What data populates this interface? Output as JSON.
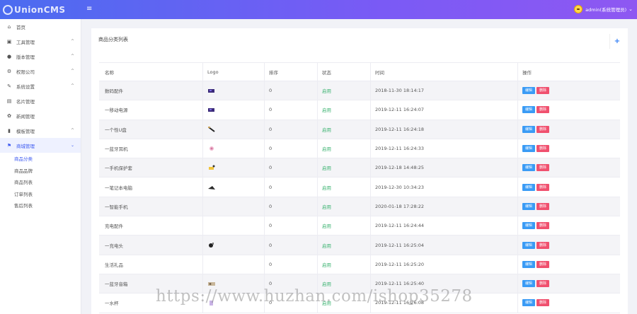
{
  "header": {
    "logo_text": "UnionCMS",
    "user_label": "admin(系统管理员)"
  },
  "sidebar": {
    "items": [
      {
        "label": "首页",
        "icon": "home-icon",
        "has_arrow": false,
        "arrow": ""
      },
      {
        "label": "工具管理",
        "icon": "tools-icon",
        "has_arrow": true,
        "arrow": "^"
      },
      {
        "label": "版本管理",
        "icon": "user-icon",
        "has_arrow": true,
        "arrow": "^"
      },
      {
        "label": "权限公司",
        "icon": "settings-icon",
        "has_arrow": true,
        "arrow": "^"
      },
      {
        "label": "系统设置",
        "icon": "wrench-icon",
        "has_arrow": true,
        "arrow": "^"
      },
      {
        "label": "名片管理",
        "icon": "card-icon",
        "has_arrow": false,
        "arrow": ""
      },
      {
        "label": "新闻管理",
        "icon": "gear-icon",
        "has_arrow": false,
        "arrow": ""
      },
      {
        "label": "模板管理",
        "icon": "file-icon",
        "has_arrow": true,
        "arrow": "^"
      },
      {
        "label": "商城管理",
        "icon": "flag-icon",
        "has_arrow": true,
        "arrow": "⌄",
        "active": true
      }
    ],
    "sub_items": [
      {
        "label": "商品分类",
        "active": true
      },
      {
        "label": "商品品牌",
        "active": false
      },
      {
        "label": "商品列表",
        "active": false
      },
      {
        "label": "订单列表",
        "active": false
      },
      {
        "label": "售后列表",
        "active": false
      }
    ]
  },
  "card": {
    "title": "商品分类列表",
    "add_icon": "+"
  },
  "table": {
    "columns": [
      "名称",
      "Logo",
      "排序",
      "状态",
      "时间",
      "操作"
    ],
    "edit_label": "编辑",
    "delete_label": "删除",
    "rows": [
      {
        "name": "数码配件",
        "logo": "purple-chip",
        "sort": "0",
        "status": "启用",
        "time": "2018-11-30 18:14:17"
      },
      {
        "name": "一移动电源",
        "logo": "purple-chip",
        "sort": "0",
        "status": "启用",
        "time": "2019-12-11 16:24:07"
      },
      {
        "name": "一个性U盘",
        "logo": "usb-stick",
        "sort": "0",
        "status": "启用",
        "time": "2019-12-11 16:24:18"
      },
      {
        "name": "一蓝牙耳机",
        "logo": "pink-earbud",
        "sort": "0",
        "status": "启用",
        "time": "2019-12-11 16:24:33"
      },
      {
        "name": "一手机保护套",
        "logo": "yellow-case",
        "sort": "0",
        "status": "启用",
        "time": "2019-12-18 14:48:25"
      },
      {
        "name": "一笔记本电脑",
        "logo": "laptop",
        "sort": "0",
        "status": "启用",
        "time": "2019-12-30 10:34:23"
      },
      {
        "name": "一智能手机",
        "logo": "",
        "sort": "0",
        "status": "启用",
        "time": "2020-01-18 17:28:22"
      },
      {
        "name": "充电配件",
        "logo": "",
        "sort": "0",
        "status": "启用",
        "time": "2019-12-11 16:24:44"
      },
      {
        "name": "一充电头",
        "logo": "charger-head",
        "sort": "0",
        "status": "启用",
        "time": "2019-12-11 16:25:04"
      },
      {
        "name": "生活礼品",
        "logo": "",
        "sort": "0",
        "status": "启用",
        "time": "2019-12-11 16:25:20"
      },
      {
        "name": "一蓝牙音箱",
        "logo": "speaker",
        "sort": "0",
        "status": "启用",
        "time": "2019-12-11 16:25:40"
      },
      {
        "name": "一水杯",
        "logo": "cup",
        "sort": "0",
        "status": "启用",
        "time": "2019-12-11 16:26:08"
      }
    ]
  },
  "watermark": "https://www.huzhan.com/ishop35278",
  "colors": {
    "accent": "#3d5af1",
    "status_green": "#3cb371",
    "edit_blue": "#3a9bf5",
    "delete_red": "#f0506e"
  }
}
